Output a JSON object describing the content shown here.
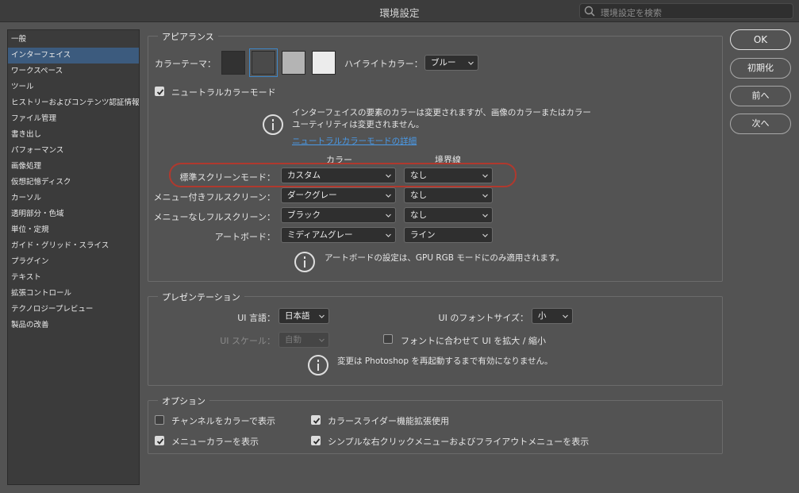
{
  "window": {
    "title": "環境設定",
    "search_placeholder": "環境設定を検索"
  },
  "sidebar": {
    "items": [
      {
        "label": "一般"
      },
      {
        "label": "インターフェイス",
        "active": true
      },
      {
        "label": "ワークスペース"
      },
      {
        "label": "ツール"
      },
      {
        "label": "ヒストリーおよびコンテンツ認証情報"
      },
      {
        "label": "ファイル管理"
      },
      {
        "label": "書き出し"
      },
      {
        "label": "パフォーマンス"
      },
      {
        "label": "画像処理"
      },
      {
        "label": "仮想記憶ディスク"
      },
      {
        "label": "カーソル"
      },
      {
        "label": "透明部分・色域"
      },
      {
        "label": "単位・定規"
      },
      {
        "label": "ガイド・グリッド・スライス"
      },
      {
        "label": "プラグイン"
      },
      {
        "label": "テキスト"
      },
      {
        "label": "拡張コントロール"
      },
      {
        "label": "テクノロジープレビュー"
      },
      {
        "label": "製品の改善"
      }
    ]
  },
  "appearance": {
    "title": "アピアランス",
    "color_theme_label": "カラーテーマ：",
    "theme_colors": [
      "#323232",
      "#4a4a4a",
      "#b4b4b4",
      "#ececec"
    ],
    "selected_theme": 1,
    "highlight_label": "ハイライトカラー：",
    "highlight_value": "ブルー",
    "neutral_label": "ニュートラルカラーモード",
    "neutral_checked": true,
    "info_line1": "インターフェイスの要素のカラーは変更されますが、画像のカラーまたはカラー",
    "info_line2": "ユーティリティは変更されません。",
    "info_link": "ニュートラルカラーモードの詳細",
    "col_color": "カラー",
    "col_border": "境界線",
    "rows": [
      {
        "label": "標準スクリーンモード：",
        "color": "カスタム",
        "border": "なし"
      },
      {
        "label": "メニュー付きフルスクリーン：",
        "color": "ダークグレー",
        "border": "なし"
      },
      {
        "label": "メニューなしフルスクリーン：",
        "color": "ブラック",
        "border": "なし"
      },
      {
        "label": "アートボード：",
        "color": "ミディアムグレー",
        "border": "ライン"
      }
    ],
    "artboard_note": "アートボードの設定は、GPU RGB モードにのみ適用されます。"
  },
  "presentation": {
    "title": "プレゼンテーション",
    "ui_lang_label": "UI 言語：",
    "ui_lang_value": "日本語",
    "font_size_label": "UI のフォントサイズ：",
    "font_size_value": "小",
    "ui_scale_label": "UI スケール：",
    "ui_scale_value": "自動",
    "scale_font_label": "フォントに合わせて UI を拡大 / 縮小",
    "scale_font_checked": false,
    "note": "変更は Photoshop を再起動するまで有効になりません。"
  },
  "options": {
    "title": "オプション",
    "channels_color": {
      "label": "チャンネルをカラーで表示",
      "checked": false
    },
    "slider_ext": {
      "label": "カラースライダー機能拡張使用",
      "checked": true
    },
    "menu_color": {
      "label": "メニューカラーを表示",
      "checked": true
    },
    "simple_menu": {
      "label": "シンプルな右クリックメニューおよびフライアウトメニューを表示",
      "checked": true
    }
  },
  "buttons": {
    "ok": "OK",
    "reset": "初期化",
    "prev": "前へ",
    "next": "次へ"
  },
  "colors": {
    "accent": "#3e87c7",
    "highlight_ring": "#b0392e",
    "link": "#4a9ae8"
  }
}
